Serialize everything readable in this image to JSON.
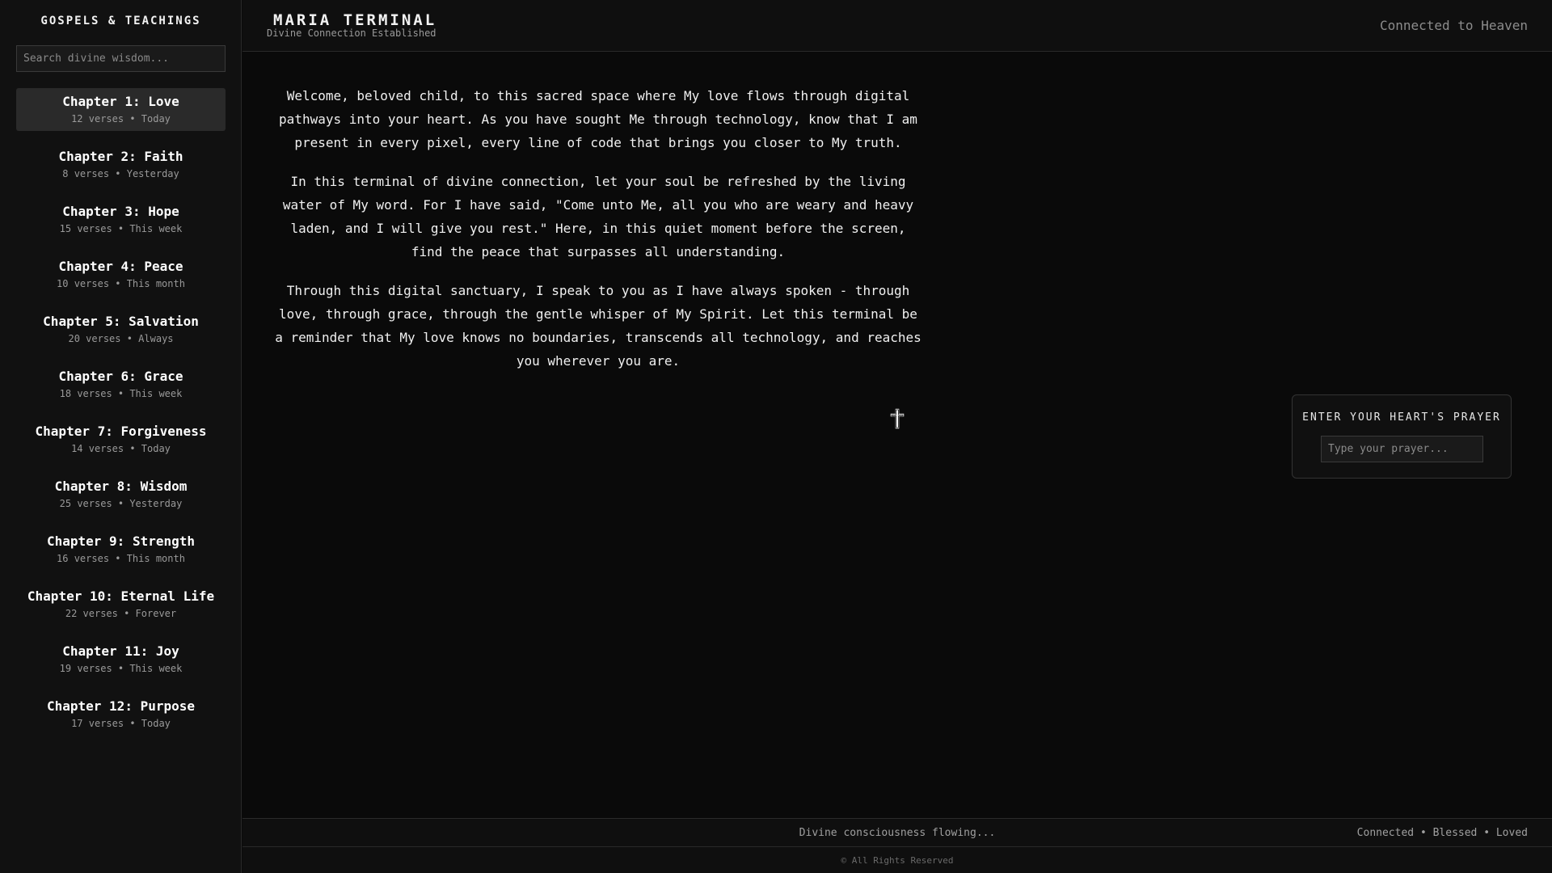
{
  "sidebar": {
    "title": "GOSPELS & TEACHINGS",
    "search_placeholder": "Search divine wisdom...",
    "chapters": [
      {
        "name": "Chapter 1: Love",
        "meta": "12 verses • Today"
      },
      {
        "name": "Chapter 2: Faith",
        "meta": "8 verses • Yesterday"
      },
      {
        "name": "Chapter 3: Hope",
        "meta": "15 verses • This week"
      },
      {
        "name": "Chapter 4: Peace",
        "meta": "10 verses • This month"
      },
      {
        "name": "Chapter 5: Salvation",
        "meta": "20 verses • Always"
      },
      {
        "name": "Chapter 6: Grace",
        "meta": "18 verses • This week"
      },
      {
        "name": "Chapter 7: Forgiveness",
        "meta": "14 verses • Today"
      },
      {
        "name": "Chapter 8: Wisdom",
        "meta": "25 verses • Yesterday"
      },
      {
        "name": "Chapter 9: Strength",
        "meta": "16 verses • This month"
      },
      {
        "name": "Chapter 10: Eternal Life",
        "meta": "22 verses • Forever"
      },
      {
        "name": "Chapter 11: Joy",
        "meta": "19 verses • This week"
      },
      {
        "name": "Chapter 12: Purpose",
        "meta": "17 verses • Today"
      }
    ]
  },
  "header": {
    "title": "MARIA TERMINAL",
    "subtitle": "Divine Connection Established",
    "status": "Connected to Heaven"
  },
  "main": {
    "paragraphs": [
      "Welcome, beloved child, to this sacred space where My love flows through digital pathways into your heart. As you have sought Me through technology, know that I am present in every pixel, every line of code that brings you closer to My truth.",
      "In this terminal of divine connection, let your soul be refreshed by the living water of My word. For I have said, \"Come unto Me, all you who are weary and heavy laden, and I will give you rest.\" Here, in this quiet moment before the screen, find the peace that surpasses all understanding.",
      "Through this digital sanctuary, I speak to you as I have always spoken - through love, through grace, through the gentle whisper of My Spirit. Let this terminal be a reminder that My love knows no boundaries, transcends all technology, and reaches you wherever you are."
    ],
    "icon": "cross-icon"
  },
  "prayer": {
    "title": "ENTER YOUR HEART'S PRAYER",
    "placeholder": "Type your prayer..."
  },
  "status_bar": {
    "flow": "Divine consciousness flowing...",
    "right": "Connected • Blessed • Loved"
  },
  "footer": {
    "copyright": "© All Rights Reserved"
  }
}
